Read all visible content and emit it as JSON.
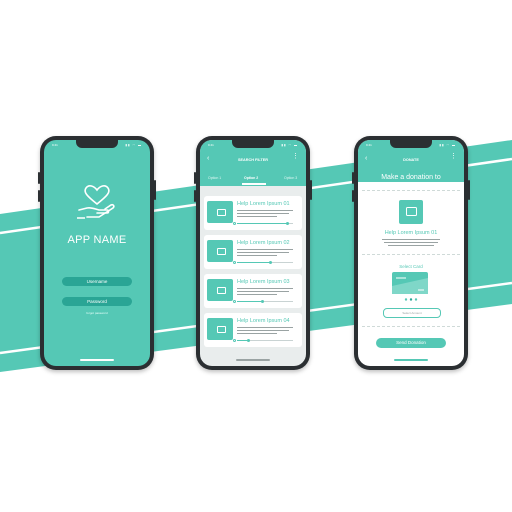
{
  "colors": {
    "accent": "#55c8b5",
    "accent_dark": "#2aa595",
    "phone_frame": "#2b2f32",
    "background": "#ffffff"
  },
  "phone1": {
    "app_name": "APP NAME",
    "icon": "heart-in-hand-icon",
    "username_label": "Username",
    "password_label": "Password",
    "forgot_text": "forgot password"
  },
  "phone2": {
    "title": "SEARCH FILTER",
    "tabs": [
      "Option 1",
      "Option 2",
      "Option 3"
    ],
    "active_tab": "Option 2",
    "items": [
      {
        "title": "Help Lorem Ipsum 01",
        "progress": 0.9
      },
      {
        "title": "Help Lorem Ipsum 02",
        "progress": 0.6
      },
      {
        "title": "Help Lorem Ipsum 03",
        "progress": 0.45
      },
      {
        "title": "Help Lorem Ipsum 04",
        "progress": 0.2
      }
    ]
  },
  "phone3": {
    "title": "DONATE",
    "subtitle": "Make a donation to",
    "cause_title": "Help Lorem Ipsum 01",
    "select_card": "Select Card",
    "amount_placeholder": "Select Amount",
    "send_button": "Send Donation"
  }
}
